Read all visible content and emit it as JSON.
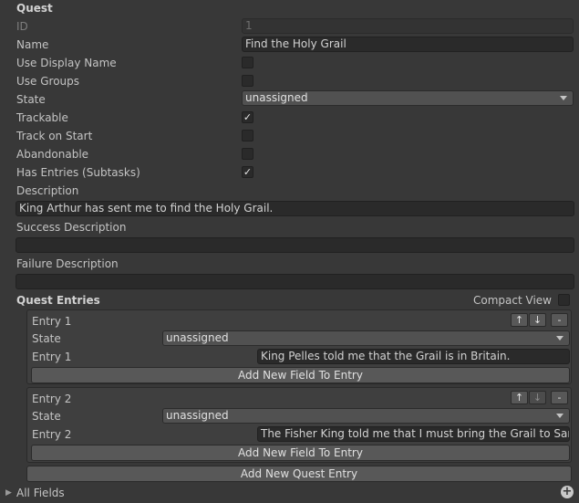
{
  "quest": {
    "header": "Quest",
    "id_label": "ID",
    "id_value": "1",
    "name_label": "Name",
    "name_value": "Find the Holy Grail",
    "use_display_name_label": "Use Display Name",
    "use_display_name_checked": false,
    "use_groups_label": "Use Groups",
    "use_groups_checked": false,
    "state_label": "State",
    "state_value": "unassigned",
    "trackable_label": "Trackable",
    "trackable_checked": true,
    "track_on_start_label": "Track on Start",
    "track_on_start_checked": false,
    "abandonable_label": "Abandonable",
    "abandonable_checked": false,
    "has_entries_label": "Has Entries (Subtasks)",
    "has_entries_checked": true,
    "description_label": "Description",
    "description_value": "King Arthur has sent me to find the Holy Grail.",
    "success_label": "Success Description",
    "success_value": "",
    "failure_label": "Failure Description",
    "failure_value": ""
  },
  "entries_section": {
    "header": "Quest Entries",
    "compact_view_label": "Compact View",
    "compact_view_checked": false,
    "entries": [
      {
        "title": "Entry 1",
        "state_label": "State",
        "state_value": "unassigned",
        "text_label": "Entry 1",
        "text_value": "King Pelles told me that the Grail is in Britain.",
        "add_field_label": "Add New Field To Entry",
        "up_glyph": "↑",
        "down_glyph": "↓",
        "remove_glyph": "-"
      },
      {
        "title": "Entry 2",
        "state_label": "State",
        "state_value": "unassigned",
        "text_label": "Entry 2",
        "text_value": "The Fisher King told me that I must bring the Grail to Sarras.",
        "add_field_label": "Add New Field To Entry",
        "up_glyph": "↑",
        "down_glyph": "↓",
        "remove_glyph": "-"
      }
    ],
    "add_entry_label": "Add New Quest Entry"
  },
  "all_fields": {
    "label": "All Fields",
    "expand_glyph": "▶",
    "add_glyph": "+"
  },
  "check_glyph": "✓",
  "icons": {
    "foldout": "foldout-arrow-icon",
    "add": "plus-circle-icon",
    "dropdown": "chevron-down-icon",
    "check": "checkmark-icon"
  }
}
